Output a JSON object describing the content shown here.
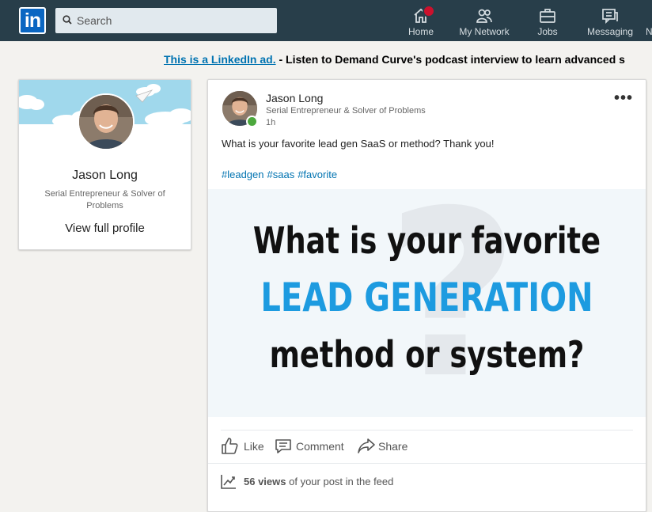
{
  "nav": {
    "logo": "in",
    "search_placeholder": "Search",
    "items": [
      {
        "label": "Home",
        "icon": "home-icon"
      },
      {
        "label": "My Network",
        "icon": "network-icon"
      },
      {
        "label": "Jobs",
        "icon": "jobs-icon"
      },
      {
        "label": "Messaging",
        "icon": "messaging-icon"
      },
      {
        "label": "N",
        "icon": "notifications-icon"
      }
    ]
  },
  "ad": {
    "link_text": "This is a LinkedIn ad.",
    "separator": " - ",
    "text": "Listen to Demand Curve's podcast interview to learn advanced s"
  },
  "profile_card": {
    "name": "Jason Long",
    "headline": "Serial Entrepreneur & Solver of Problems",
    "view_profile": "View full profile"
  },
  "post": {
    "author": "Jason Long",
    "author_headline": "Serial Entrepreneur & Solver of Problems",
    "time": "1h",
    "more": "•••",
    "text": "What is your favorite lead gen SaaS or method? Thank you!",
    "hashtags": [
      "#leadgen",
      "#saas",
      "#favorite"
    ],
    "image": {
      "line1": "What is your favorite",
      "line2": "LEAD GENERATION",
      "line3": "method or system?",
      "bg_glyph": "?"
    },
    "actions": {
      "like": "Like",
      "comment": "Comment",
      "share": "Share"
    },
    "views": {
      "count": "56 views",
      "suffix": " of your post in the feed"
    }
  },
  "colors": {
    "nav_bg": "#283e4a",
    "brand_blue": "#0073b1",
    "accent_blue": "#1d9be0",
    "badge_red": "#cb112d",
    "online_green": "#4ca83d"
  }
}
